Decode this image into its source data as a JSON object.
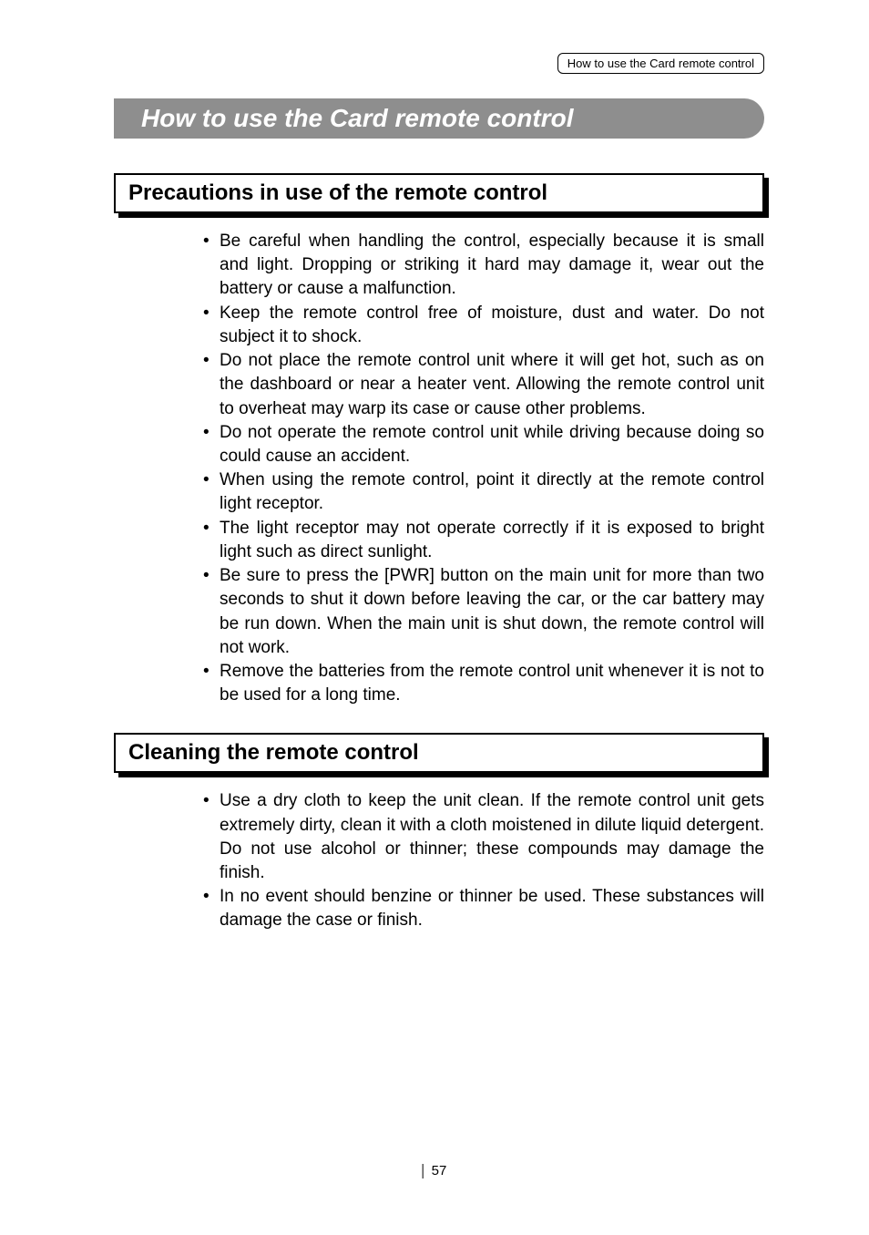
{
  "header_tag": "How to use the Card remote control",
  "title": "How to use the Card remote control",
  "section1": {
    "heading": "Precautions in use of the remote control",
    "items": [
      "Be careful when handling the control, especially because it is small and light. Dropping or striking it hard may damage it, wear out the battery or cause a malfunction.",
      "Keep the remote control free of moisture, dust and water. Do not subject it to shock.",
      "Do not place the remote control unit where it will get hot, such as on the dashboard or near a heater vent.  Allowing the remote control unit to overheat may warp its case or cause other problems.",
      "Do not operate the remote control unit while driving because doing so could cause an accident.",
      "When using the remote control, point it directly at the remote control light receptor.",
      "The light receptor may not operate correctly if it is exposed to bright light such as direct sunlight.",
      "Be sure to press the [PWR] button on the main unit for more than two seconds to shut it down before leaving the car, or the car battery may be run down. When the main unit is shut down, the remote control will not work.",
      "Remove the batteries from the remote control unit whenever it is not to be used for a long time."
    ]
  },
  "section2": {
    "heading": "Cleaning the remote control",
    "items": [
      "Use a dry cloth to keep the unit clean.  If the remote control unit gets extremely dirty, clean it with a cloth moistened in dilute liquid detergent.  Do not use alcohol or thinner; these compounds may damage the finish.",
      "In no event should benzine or thinner be used. These substances will damage the case or finish."
    ]
  },
  "page_number": "57"
}
